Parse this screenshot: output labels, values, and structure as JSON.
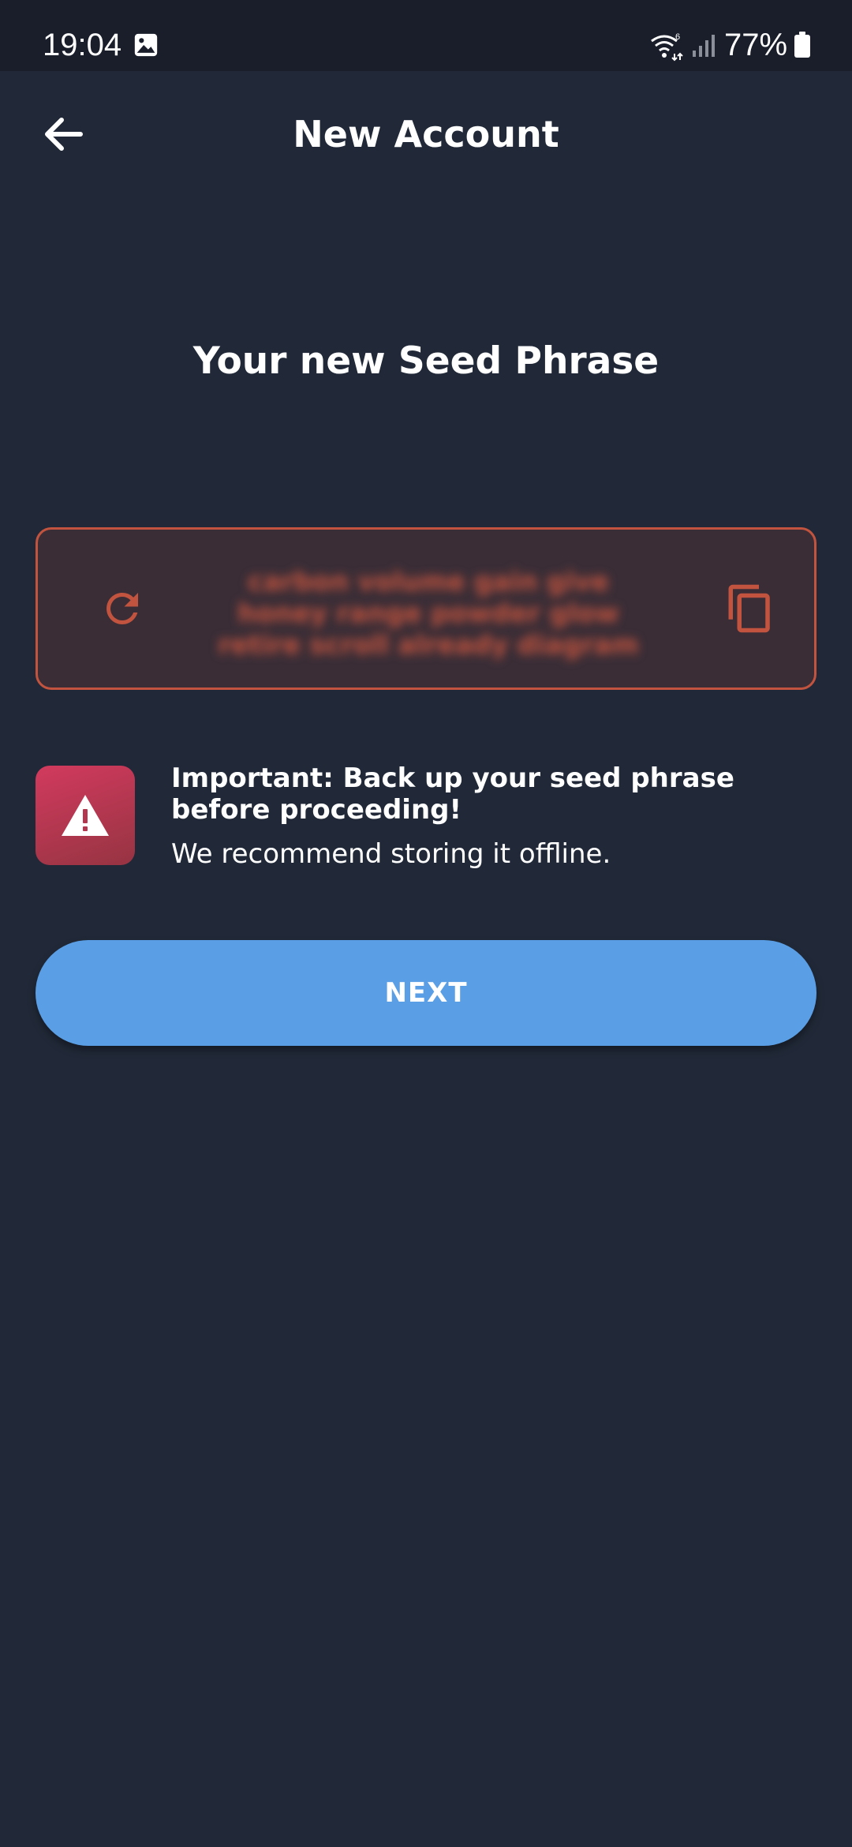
{
  "status_bar": {
    "time": "19:04",
    "battery": "77%",
    "icons": [
      "gallery-icon",
      "wifi-icon",
      "signal-icon",
      "battery-icon"
    ]
  },
  "header": {
    "title": "New Account",
    "back_icon": "arrow-left-icon"
  },
  "main": {
    "heading": "Your new Seed Phrase",
    "seed_phrase": "carbon volume gain give honey range powder glow retire scroll already diagram",
    "refresh_icon": "refresh-icon",
    "copy_icon": "copy-icon"
  },
  "warning": {
    "icon": "warning-icon",
    "title": "Important: Back up your seed phrase before proceeding!",
    "subtitle": "We recommend storing it offline."
  },
  "actions": {
    "next_label": "NEXT"
  },
  "colors": {
    "background": "#212938",
    "status_bar": "#191e2a",
    "accent_red": "#c2543f",
    "seed_box_bg": "#3a2d36",
    "warning_gradient_start": "#d23a5e",
    "warning_gradient_end": "#963442",
    "button_blue": "#5a9fe6"
  }
}
